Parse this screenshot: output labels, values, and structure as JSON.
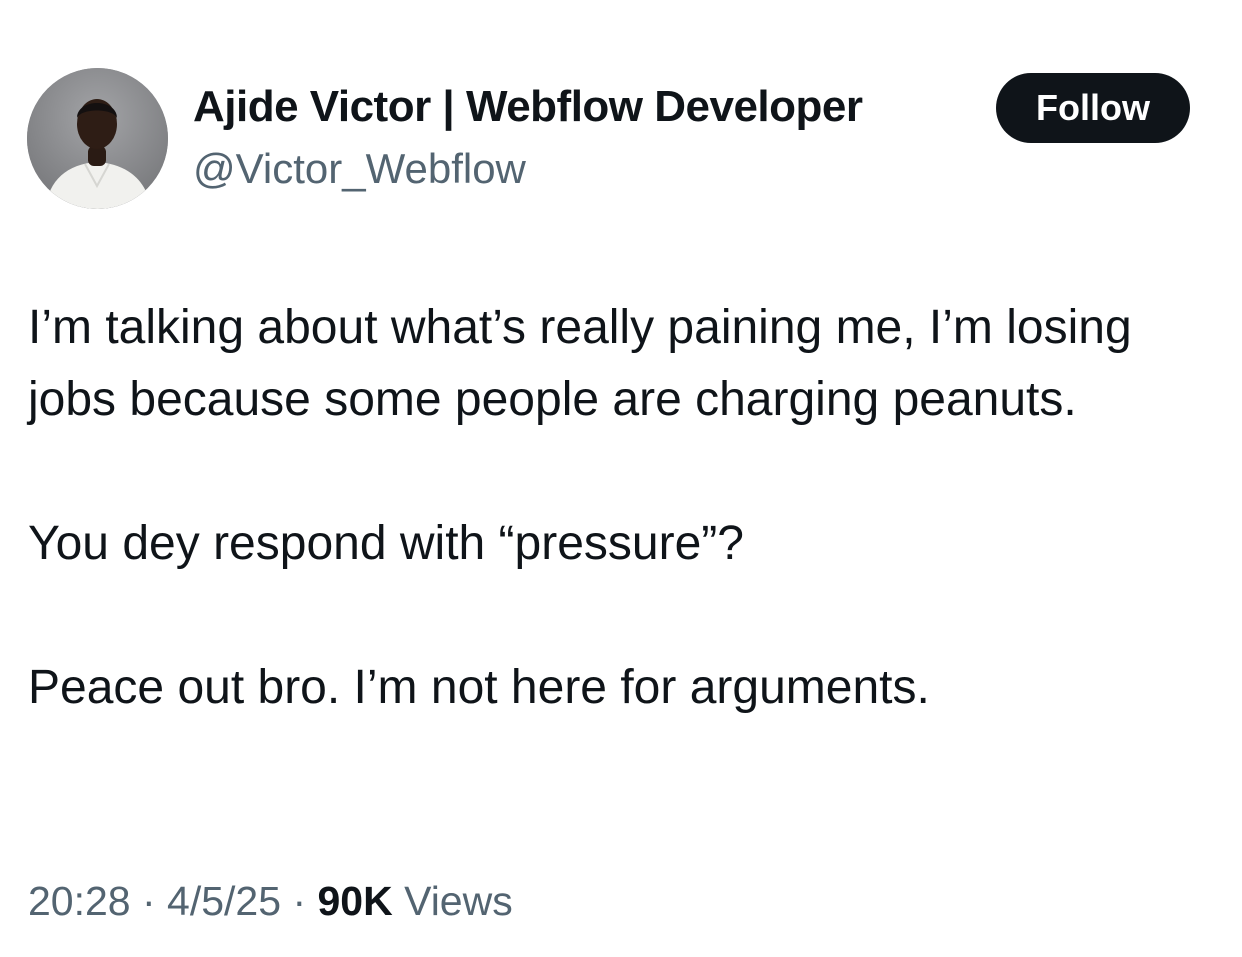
{
  "author": {
    "display_name": "Ajide Victor | Webflow Developer",
    "handle": "@Victor_Webflow"
  },
  "follow_button": {
    "label": "Follow"
  },
  "tweet": {
    "paragraphs": [
      "I’m talking about what’s really paining me, I’m losing jobs because some people are charging peanuts.",
      "You dey respond with “pressure”?",
      "Peace out bro. I’m not here for arguments."
    ]
  },
  "meta": {
    "time": "20:28",
    "separator": " · ",
    "date": "4/5/25",
    "views_count": "90K",
    "views_label": " Views"
  },
  "colors": {
    "text_primary": "#0f1419",
    "text_secondary": "#536471",
    "button_bg": "#0f1419",
    "button_text": "#ffffff"
  }
}
